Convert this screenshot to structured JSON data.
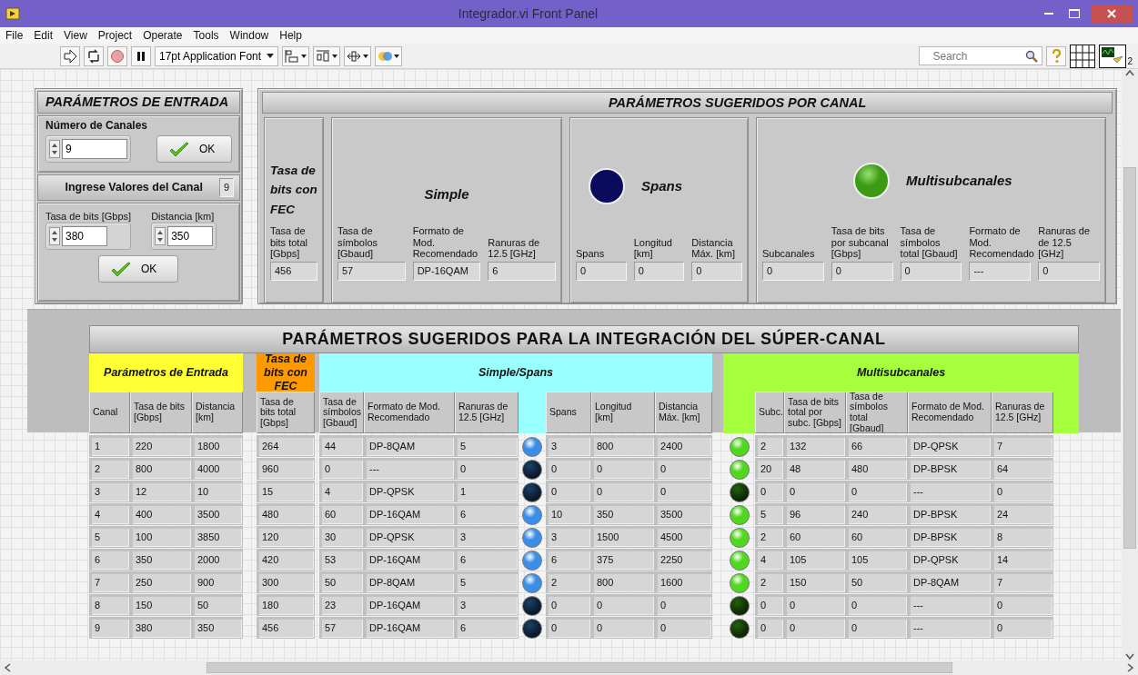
{
  "window": {
    "title": "Integrador.vi Front Panel"
  },
  "menu": [
    "File",
    "Edit",
    "View",
    "Project",
    "Operate",
    "Tools",
    "Window",
    "Help"
  ],
  "toolbar": {
    "font": "17pt Application Font",
    "search": {
      "placeholder": "Search"
    },
    "vi_icon_number": "2"
  },
  "entrada": {
    "title": "PARÁMETROS DE ENTRADA",
    "channels_label": "Número de Canales",
    "channels_value": "9",
    "ok": "OK",
    "prompt": "Ingrese Valores del Canal",
    "index": "9",
    "fields": [
      {
        "label": "Tasa de bits [Gbps]",
        "value": "380"
      },
      {
        "label": "Distancia [km]",
        "value": "350"
      }
    ],
    "ok2": "OK"
  },
  "per_channel": {
    "title": "PARÁMETROS SUGERIDOS POR CANAL",
    "groups": [
      {
        "kind": "fec",
        "title": "Tasa de bits con FEC",
        "fields": [
          {
            "label": "Tasa de bits total [Gbps]",
            "value": "456"
          }
        ]
      },
      {
        "kind": "plain",
        "title": "Simple",
        "fields": [
          {
            "label": "Tasa de símbolos [Gbaud]",
            "value": "57"
          },
          {
            "label": "Formato de Mod. Recomendado",
            "value": "DP-16QAM"
          },
          {
            "label": "Ranuras de 12.5 [GHz]",
            "value": "6"
          }
        ]
      },
      {
        "kind": "led",
        "title": "Spans",
        "color": "#0b0b5e",
        "on": false,
        "fields": [
          {
            "label": "Spans",
            "value": "0"
          },
          {
            "label": "Longitud [km]",
            "value": "0"
          },
          {
            "label": "Distancia Máx. [km]",
            "value": "0"
          }
        ]
      },
      {
        "kind": "led",
        "title": "Multisubcanales",
        "color": "#3c9a14",
        "on": true,
        "fields": [
          {
            "label": "Subcanales",
            "value": "0"
          },
          {
            "label": "Tasa de bits por subcanal [Gbps]",
            "value": "0"
          },
          {
            "label": "Tasa de símbolos total [Gbaud]",
            "value": "0"
          },
          {
            "label": "Formato de Mod. Recomendado",
            "value": "---"
          },
          {
            "label": "Ranuras de de 12.5 [GHz]",
            "value": "0"
          }
        ]
      }
    ]
  },
  "integration": {
    "title": "PARÁMETROS SUGERIDOS PARA LA INTEGRACIÓN DEL SÚPER-CANAL",
    "groups": [
      {
        "title": "Parámetros de Entrada",
        "color": "#ffff33",
        "columns": [
          {
            "kind": "text",
            "label": "Canal"
          },
          {
            "kind": "text",
            "label": "Tasa de bits [Gbps]"
          },
          {
            "kind": "text",
            "label": "Distancia [km]"
          }
        ]
      },
      {
        "title": "Tasa de bits con FEC",
        "color": "#ff9900",
        "columns": [
          {
            "kind": "text",
            "label": "Tasa de bits total [Gbps]"
          }
        ]
      },
      {
        "title": "Simple/Spans",
        "color": "#99ffff",
        "columns": [
          {
            "kind": "text",
            "label": "Tasa de símbolos [Gbaud]"
          },
          {
            "kind": "text",
            "label": "Formato de Mod. Recomendado"
          },
          {
            "kind": "text",
            "label": "Ranuras de 12.5 [GHz]"
          },
          {
            "kind": "led",
            "color": "#3a8ee8"
          },
          {
            "kind": "text",
            "label": "Spans"
          },
          {
            "kind": "text",
            "label": "Longitud [km]"
          },
          {
            "kind": "text",
            "label": "Distancia Máx. [km]"
          }
        ]
      },
      {
        "title": "Multisubcanales",
        "color": "#a6ff3c",
        "columns": [
          {
            "kind": "led",
            "color": "#4fd81e"
          },
          {
            "kind": "text",
            "label": "Subc."
          },
          {
            "kind": "text",
            "label": "Tasa de bits total por subc. [Gbps]"
          },
          {
            "kind": "text",
            "label": "Tasa de símbolos total [Gbaud]"
          },
          {
            "kind": "text",
            "label": "Formato de Mod. Recomendado"
          },
          {
            "kind": "text",
            "label": "Ranuras de 12.5 [GHz]"
          }
        ]
      }
    ],
    "rows": [
      {
        "values": [
          "1",
          "220",
          "1800",
          "264",
          "44",
          "DP-8QAM",
          "5",
          "3",
          "800",
          "2400",
          "2",
          "132",
          "66",
          "DP-QPSK",
          "7"
        ],
        "leds": [
          true,
          true
        ]
      },
      {
        "values": [
          "2",
          "800",
          "4000",
          "960",
          "0",
          "---",
          "0",
          "0",
          "0",
          "0",
          "20",
          "48",
          "480",
          "DP-BPSK",
          "64"
        ],
        "leds": [
          false,
          true
        ]
      },
      {
        "values": [
          "3",
          "12",
          "10",
          "15",
          "4",
          "DP-QPSK",
          "1",
          "0",
          "0",
          "0",
          "0",
          "0",
          "0",
          "---",
          "0"
        ],
        "leds": [
          false,
          false
        ]
      },
      {
        "values": [
          "4",
          "400",
          "3500",
          "480",
          "60",
          "DP-16QAM",
          "6",
          "10",
          "350",
          "3500",
          "5",
          "96",
          "240",
          "DP-BPSK",
          "24"
        ],
        "leds": [
          true,
          true
        ]
      },
      {
        "values": [
          "5",
          "100",
          "3850",
          "120",
          "30",
          "DP-QPSK",
          "3",
          "3",
          "1500",
          "4500",
          "2",
          "60",
          "60",
          "DP-BPSK",
          "8"
        ],
        "leds": [
          true,
          true
        ]
      },
      {
        "values": [
          "6",
          "350",
          "2000",
          "420",
          "53",
          "DP-16QAM",
          "6",
          "6",
          "375",
          "2250",
          "4",
          "105",
          "105",
          "DP-QPSK",
          "14"
        ],
        "leds": [
          true,
          true
        ]
      },
      {
        "values": [
          "7",
          "250",
          "900",
          "300",
          "50",
          "DP-8QAM",
          "5",
          "2",
          "800",
          "1600",
          "2",
          "150",
          "50",
          "DP-8QAM",
          "7"
        ],
        "leds": [
          true,
          true
        ]
      },
      {
        "values": [
          "8",
          "150",
          "50",
          "180",
          "23",
          "DP-16QAM",
          "3",
          "0",
          "0",
          "0",
          "0",
          "0",
          "0",
          "---",
          "0"
        ],
        "leds": [
          false,
          false
        ]
      },
      {
        "values": [
          "9",
          "380",
          "350",
          "456",
          "57",
          "DP-16QAM",
          "6",
          "0",
          "0",
          "0",
          "0",
          "0",
          "0",
          "---",
          "0"
        ],
        "leds": [
          false,
          false
        ]
      }
    ]
  }
}
